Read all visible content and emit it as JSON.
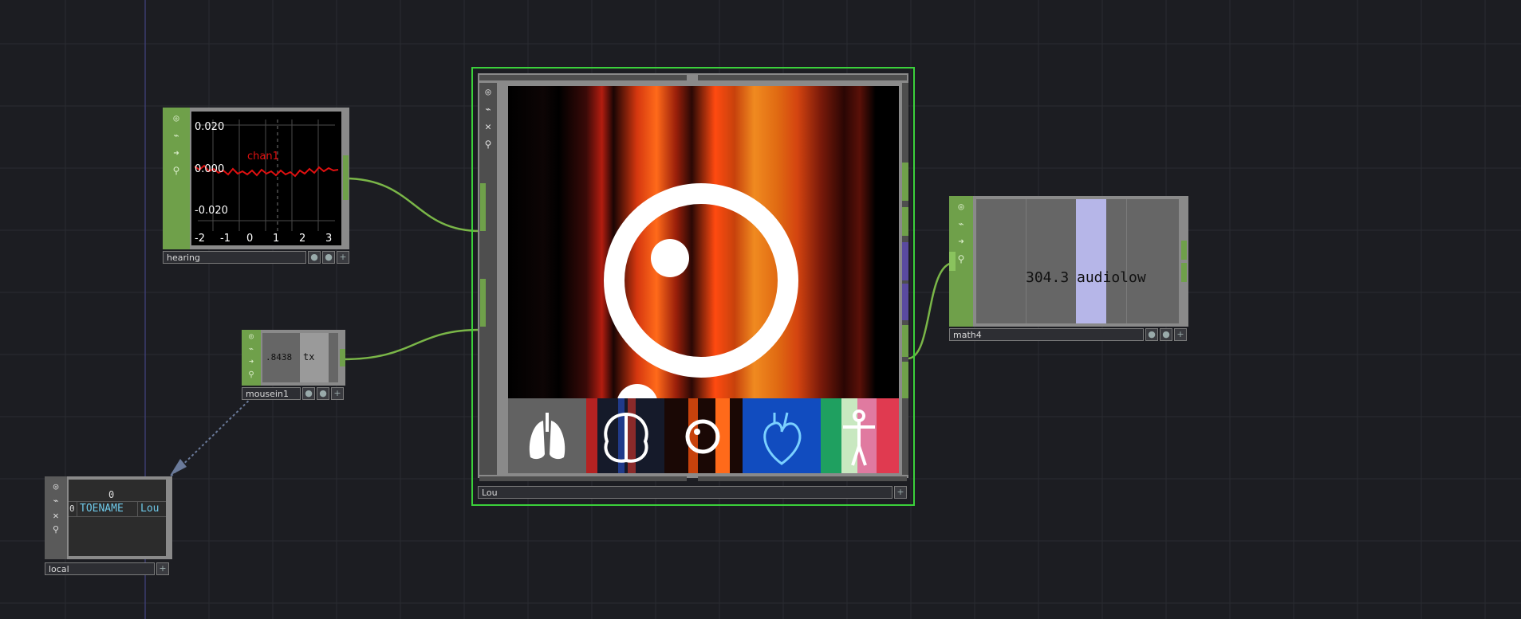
{
  "nodes": {
    "hearing": {
      "label": "hearing",
      "channel": "chan1",
      "y_ticks": [
        "0.020",
        "0.000",
        "-0.020"
      ],
      "x_ticks": [
        "-2",
        "-1",
        "0",
        "1",
        "2",
        "3"
      ]
    },
    "mousein": {
      "label": "mousein1",
      "value": ".8438",
      "channel": "tx"
    },
    "local": {
      "label": "local",
      "col_index": "0",
      "row_index": "0",
      "cell_name": "TOENAME",
      "cell_value": "Lou"
    },
    "lou": {
      "label": "Lou"
    },
    "math4": {
      "label": "math4",
      "value": "304.3",
      "channel": "audiolow"
    }
  },
  "icons": {
    "viewer": "viewer-icon",
    "bypass": "bypass-icon",
    "export": "export-arrow-icon",
    "lock": "lock-icon",
    "close": "close-x-icon",
    "add": "plus-icon"
  },
  "colors": {
    "background": "#1c1d22",
    "node_green": "#6fa04a",
    "wire_green": "#7ab648",
    "selection": "#3bd13b",
    "trace_red": "#e01010"
  }
}
